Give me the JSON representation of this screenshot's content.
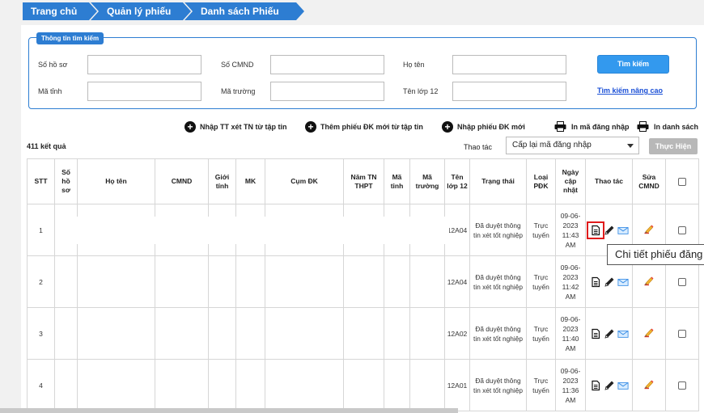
{
  "breadcrumb": [
    "Trang chủ",
    "Quản lý phiếu ĐK",
    "Danh sách Phiếu ĐK"
  ],
  "search": {
    "legend": "Thông tin tìm kiếm",
    "labels": {
      "so_ho_so": "Số hồ sơ",
      "so_cmnd": "Số CMND",
      "ho_ten": "Họ tên",
      "ma_tinh": "Mã tỉnh",
      "ma_truong": "Mã trường",
      "ten_lop_12": "Tên lớp 12"
    },
    "button": "Tìm kiếm",
    "advanced_link": "Tìm kiếm nâng cao"
  },
  "actions": {
    "import_tn": "Nhập TT xét TN từ tập tin",
    "add_from_file": "Thêm phiếu ĐK mới từ tập tin",
    "import_form": "Nhập phiếu ĐK mới",
    "print_login": "In mã đăng nhập",
    "print_list": "In danh sách"
  },
  "result_count": "411 kết quả",
  "bulk": {
    "label": "Thao tác",
    "selected": "Cấp lại mã đăng nhập",
    "execute": "Thực Hiện"
  },
  "table": {
    "headers": {
      "stt": "STT",
      "so_ho_so": "Số hồ sơ",
      "ho_ten": "Họ tên",
      "cmnd": "CMND",
      "gioi_tinh": "Giới tính",
      "mk": "MK",
      "cum_dk": "Cụm ĐK",
      "nam_tn": "Năm TN THPT",
      "ma_tinh": "Mã tỉnh",
      "ma_truong": "Mã trường",
      "ten_lop": "Tên lớp 12",
      "trang_thai": "Trạng thái",
      "loai_pdk": "Loại PĐK",
      "ngay_cap_nhat": "Ngày cập nhật",
      "thao_tac": "Thao tác",
      "sua_cmnd": "Sửa CMND"
    },
    "rows": [
      {
        "stt": "1",
        "lop": "12A04",
        "status": "Đã duyệt thông tin xét tốt nghiệp",
        "type": "Trực tuyến",
        "date": "09-06-2023 11:43 AM"
      },
      {
        "stt": "2",
        "lop": "12A04",
        "status": "Đã duyệt thông tin xét tốt nghiệp",
        "type": "Trực tuyến",
        "date": "09-06-2023 11:42 AM"
      },
      {
        "stt": "3",
        "lop": "12A02",
        "status": "Đã duyệt thông tin xét tốt nghiệp",
        "type": "Trực tuyến",
        "date": "09-06-2023 11:40 AM"
      },
      {
        "stt": "4",
        "lop": "12A01",
        "status": "Đã duyệt thông tin xét tốt nghiệp",
        "type": "Trực tuyến",
        "date": "09-06-2023 11:36 AM"
      }
    ]
  },
  "tooltip": "Chi tiết phiếu đăng ký",
  "icons": {
    "detail": "document-icon",
    "edit": "pencil-icon",
    "mail": "envelope-icon",
    "edit_cmnd": "edit-pen-icon",
    "plus": "plus-circle-icon",
    "print": "printer-icon"
  }
}
